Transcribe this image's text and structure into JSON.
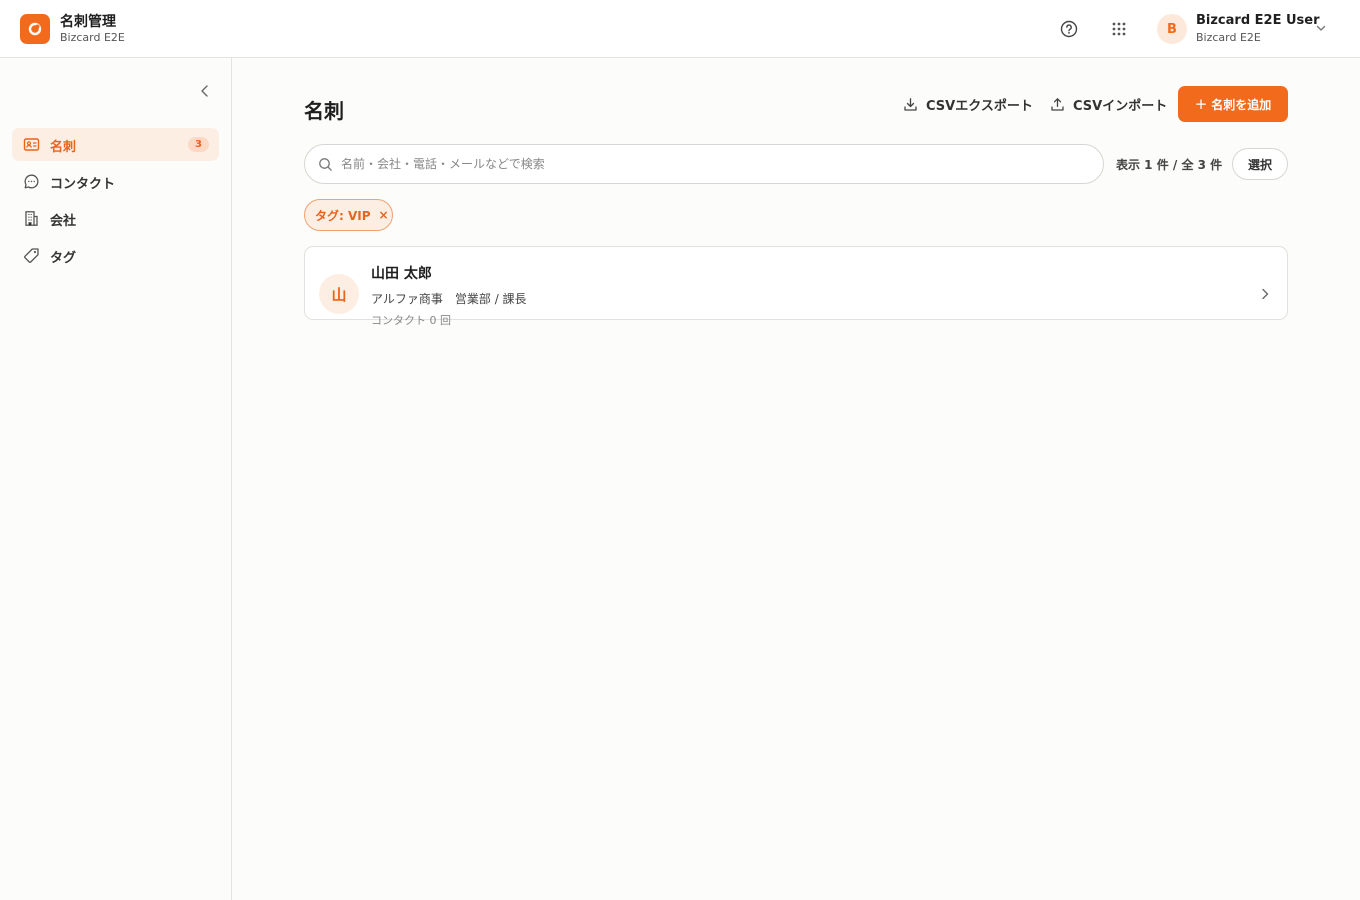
{
  "header": {
    "app_title": "名刺管理",
    "app_subtitle": "Bizcard E2E",
    "user_initial": "B",
    "user_name": "Bizcard E2E User",
    "user_org": "Bizcard E2E"
  },
  "sidebar": {
    "items": [
      {
        "label": "名刺",
        "badge": "3",
        "icon": "id-card-icon",
        "active": true
      },
      {
        "label": "コンタクト",
        "icon": "chat-bubble-icon"
      },
      {
        "label": "会社",
        "icon": "building-icon"
      },
      {
        "label": "タグ",
        "icon": "tag-icon"
      }
    ]
  },
  "main": {
    "title": "名刺",
    "export_label": "CSVエクスポート",
    "import_label": "CSVインポート",
    "add_label": "名刺を追加",
    "search_placeholder": "名前・会社・電話・メールなどで検索",
    "count_text": "表示 1 件 / 全 3 件",
    "select_label": "選択",
    "filter_tag": "タグ: VIP",
    "filter_remove": "×"
  },
  "cards": [
    {
      "initial": "山",
      "name": "山田 太郎",
      "meta": "アルファ商事　営業部 / 課長",
      "contacts": "コンタクト 0 回"
    }
  ],
  "colors": {
    "accent": "#f26b1d",
    "accent_soft": "#fdeee4"
  }
}
